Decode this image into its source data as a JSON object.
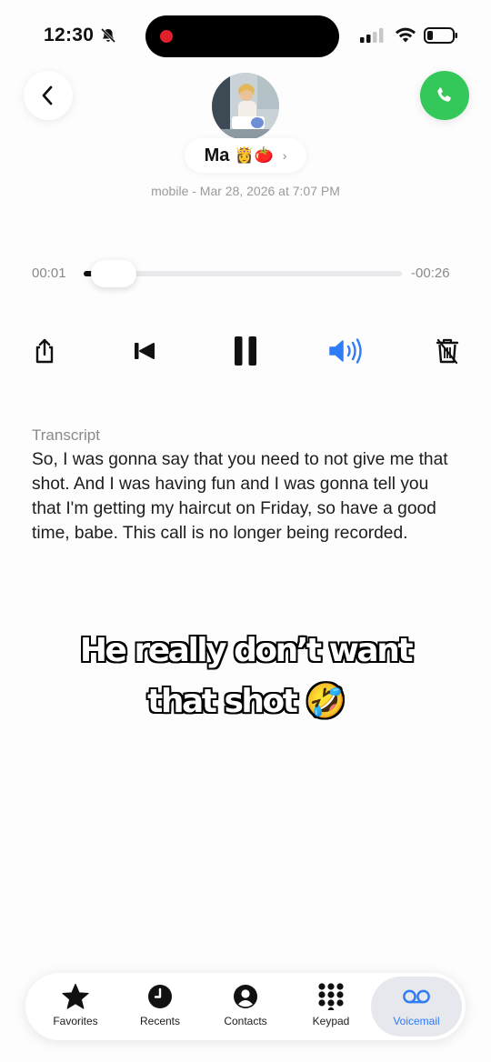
{
  "status_bar": {
    "time": "12:30"
  },
  "header": {
    "contact_name": "Ma",
    "name_emoji": "👸🍅",
    "chevron": "›",
    "subtitle": "mobile - Mar 28, 2026 at 7:07 PM"
  },
  "player": {
    "elapsed": "00:01",
    "remaining": "-00:26",
    "progress": 0.04
  },
  "transcript": {
    "label": "Transcript",
    "text": "So, I was gonna say that you need to not give me that shot.  And I was having fun and I was gonna tell you that I'm getting my haircut on Friday, so have a good time, babe.  This call is no longer being recorded."
  },
  "caption": {
    "line1": "He really don’t want",
    "line2": "that shot 🤣"
  },
  "tabs": [
    {
      "label": "Favorites",
      "icon": "star-icon"
    },
    {
      "label": "Recents",
      "icon": "clock-icon"
    },
    {
      "label": "Contacts",
      "icon": "person-circle-icon"
    },
    {
      "label": "Keypad",
      "icon": "keypad-icon"
    },
    {
      "label": "Voicemail",
      "icon": "voicemail-icon",
      "active": true
    }
  ],
  "colors": {
    "accent": "#2f7cf6",
    "call_green": "#34c759",
    "recording_red": "#e0202a"
  }
}
